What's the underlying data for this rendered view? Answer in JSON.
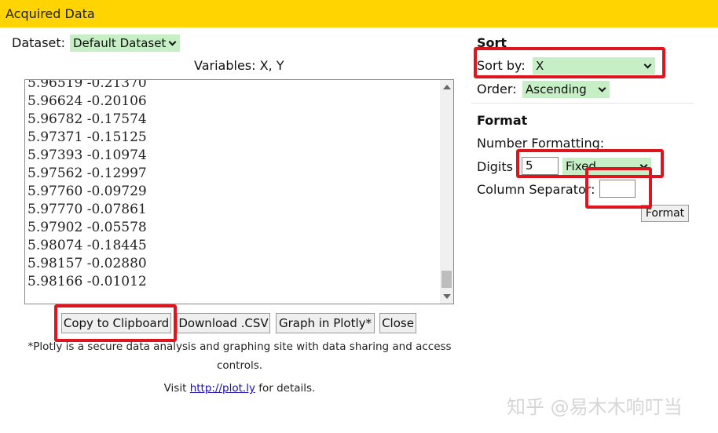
{
  "window": {
    "title": "Acquired Data"
  },
  "dataset": {
    "label": "Dataset:",
    "selected": "Default Dataset"
  },
  "variables_label": "Variables: X, Y",
  "data_lines": [
    "5.96519 -0.21370",
    "5.96624 -0.20106",
    "5.96782 -0.17574",
    "5.97371 -0.15125",
    "5.97393 -0.10974",
    "5.97562 -0.12997",
    "5.97760 -0.09729",
    "5.97770 -0.07861",
    "5.97902 -0.05578",
    "5.98074 -0.18445",
    "5.98157 -0.02880",
    "5.98166 -0.01012"
  ],
  "buttons": {
    "copy": "Copy to Clipboard",
    "download": "Download .CSV",
    "plotly": "Graph in Plotly*",
    "close": "Close",
    "format": "Format"
  },
  "notes": {
    "plotly_line1": "*Plotly is a secure data analysis and graphing site with data sharing and access",
    "plotly_line2": "controls.",
    "visit_prefix": "Visit",
    "visit_link": "http://plot.ly",
    "visit_suffix": "for details."
  },
  "sort": {
    "heading": "Sort",
    "sort_by_label": "Sort by:",
    "sort_by_value": "X",
    "order_label": "Order:",
    "order_value": "Ascending"
  },
  "format": {
    "heading": "Format",
    "number_formatting_label": "Number Formatting:",
    "digits_label": "Digits",
    "digits_value": "5",
    "digits_mode": "Fixed",
    "column_separator_label": "Column Separator:",
    "column_separator_value": ""
  },
  "watermark": "知乎 @易木木响叮当",
  "colors": {
    "titlebar": "#ffd400",
    "select_bg": "#c6efc6",
    "highlight": "#e0141e",
    "link": "#1a0dab"
  }
}
